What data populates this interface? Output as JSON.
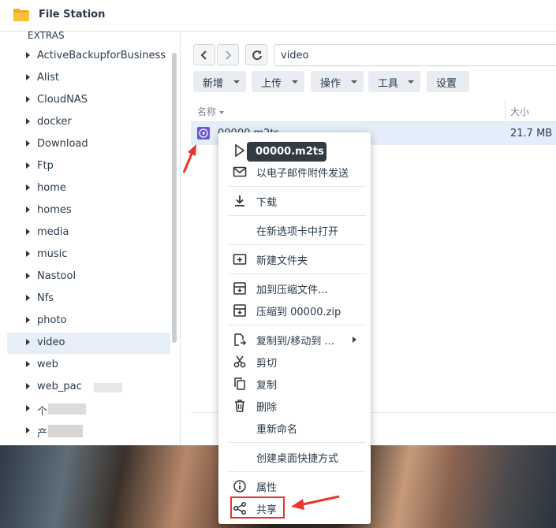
{
  "app": {
    "title": "File Station"
  },
  "sidebar": {
    "partial_top_label": "EXTRAS",
    "items": [
      {
        "label": "ActiveBackupforBusiness"
      },
      {
        "label": "Alist"
      },
      {
        "label": "CloudNAS"
      },
      {
        "label": "docker"
      },
      {
        "label": "Download"
      },
      {
        "label": "Ftp"
      },
      {
        "label": "home"
      },
      {
        "label": "homes"
      },
      {
        "label": "media"
      },
      {
        "label": "music"
      },
      {
        "label": "Nastool"
      },
      {
        "label": "Nfs"
      },
      {
        "label": "photo"
      },
      {
        "label": "video",
        "selected": true
      },
      {
        "label": "web"
      },
      {
        "label": "web_pac"
      },
      {
        "label": "个"
      },
      {
        "label": "产"
      }
    ]
  },
  "toolbar": {
    "path": "video",
    "buttons": [
      {
        "label": "新增"
      },
      {
        "label": "上传"
      },
      {
        "label": "操作"
      },
      {
        "label": "工具"
      },
      {
        "label": "设置"
      }
    ]
  },
  "file_list": {
    "columns": {
      "name": "名称",
      "size": "大小"
    },
    "rows": [
      {
        "name": "00000.m2ts",
        "size": "21.7 MB",
        "icon": "video-file-icon"
      }
    ]
  },
  "tooltip": "00000.m2ts",
  "context_menu": {
    "items": [
      {
        "label": "播放",
        "icon": "play-icon"
      },
      {
        "label": "以电子邮件附件发送",
        "icon": "mail-icon"
      },
      {
        "label": "下载",
        "icon": "download-icon"
      },
      {
        "label": "在新选项卡中打开",
        "icon": ""
      },
      {
        "label": "新建文件夹",
        "icon": "new-folder-icon"
      },
      {
        "label": "加到压缩文件...",
        "icon": "archive-icon"
      },
      {
        "label": "压缩到 00000.zip",
        "icon": "archive-icon"
      },
      {
        "label": "复制到/移动到 ...",
        "icon": "copy-move-icon"
      },
      {
        "label": "剪切",
        "icon": "scissors-icon"
      },
      {
        "label": "复制",
        "icon": "copy-icon"
      },
      {
        "label": "删除",
        "icon": "trash-icon"
      },
      {
        "label": "重新命名",
        "icon": ""
      },
      {
        "label": "创建桌面快捷方式",
        "icon": ""
      },
      {
        "label": "属性",
        "icon": "info-icon"
      },
      {
        "label": "共享",
        "icon": "share-icon"
      }
    ]
  },
  "colors": {
    "accent": "#e8362d",
    "selection": "#e3eefa",
    "video_icon": "#6a55d6"
  }
}
